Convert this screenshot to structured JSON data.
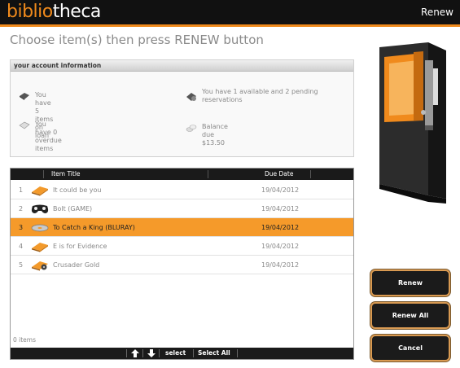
{
  "header": {
    "logo_part1": "biblio",
    "logo_part2": "theca",
    "screen_name": "Renew"
  },
  "instruction": "Choose item(s) then press RENEW button",
  "account": {
    "heading": "your account information",
    "loans": "You have 5 items on loan",
    "available": "You have 1 available and 2 pending reservations",
    "overdue": "You have 0 overdue items",
    "balance": "Balance due $13.50"
  },
  "list": {
    "columns": {
      "title": "Item Title",
      "due": "Due Date"
    },
    "rows": [
      {
        "num": "1",
        "icon": "book-icon",
        "title": "It could be you",
        "due": "19/04/2012",
        "selected": false
      },
      {
        "num": "2",
        "icon": "gamepad-icon",
        "title": "Bolt (GAME)",
        "due": "19/04/2012",
        "selected": false
      },
      {
        "num": "3",
        "icon": "disc-icon",
        "title": "To Catch a King (BLURAY)",
        "due": "19/04/2012",
        "selected": true
      },
      {
        "num": "4",
        "icon": "book-icon",
        "title": "E is for Evidence",
        "due": "19/04/2012",
        "selected": false
      },
      {
        "num": "5",
        "icon": "audiobook-icon",
        "title": "Crusader Gold",
        "due": "19/04/2012",
        "selected": false
      }
    ],
    "count_label": "0 items",
    "footer": {
      "select": "select",
      "select_all": "Select All"
    }
  },
  "buttons": {
    "renew": "Renew",
    "renew_all": "Renew All",
    "cancel": "Cancel"
  },
  "colors": {
    "accent": "#f08a1c",
    "selected_row": "#f59a2a",
    "header_bg": "#111111"
  }
}
